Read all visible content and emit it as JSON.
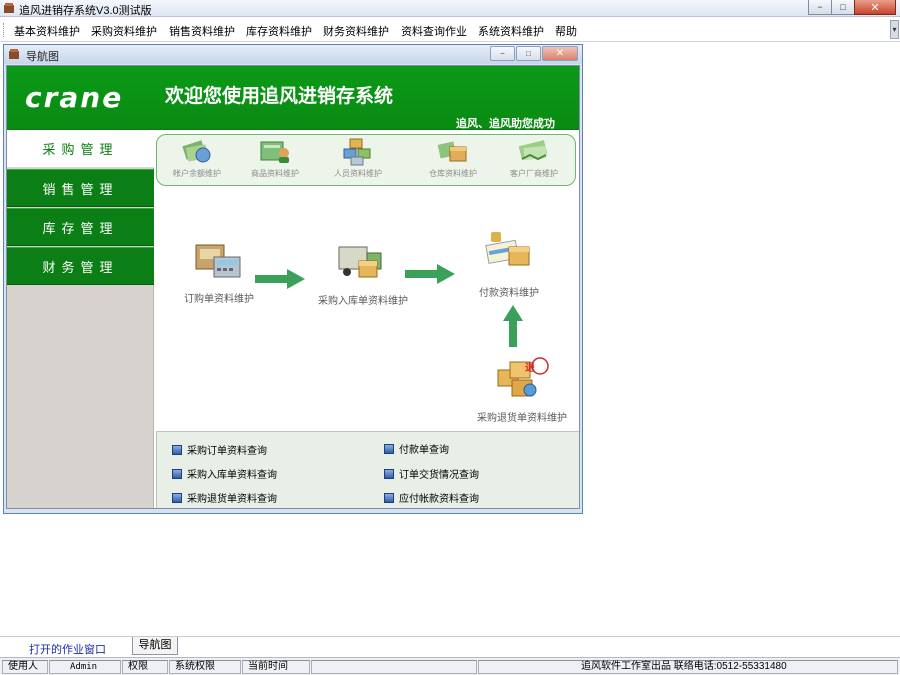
{
  "app": {
    "title": "追风进销存系统V3.0测试版"
  },
  "window_controls": {
    "minimize": "−",
    "maximize": "□",
    "close": "✕"
  },
  "menu": [
    "基本资料维护",
    "采购资料维护",
    "销售资料维护",
    "库存资料维护",
    "财务资料维护",
    "资料查询作业",
    "系统资料维护",
    "帮助"
  ],
  "child_window": {
    "title": "导航图"
  },
  "banner": {
    "logo": "crane",
    "welcome": "欢迎您使用追风进销存系统",
    "slogan": "追风、追风助您成功"
  },
  "nav": [
    {
      "label": "采购管理",
      "active": true
    },
    {
      "label": "销售管理",
      "active": false
    },
    {
      "label": "库存管理",
      "active": false
    },
    {
      "label": "财务管理",
      "active": false
    }
  ],
  "resources": [
    "帐户余额维护",
    "商品资料维护",
    "人员资料维护",
    "仓库资料维护",
    "客户厂商维护"
  ],
  "flow": {
    "order": "订购单资料维护",
    "receive": "采购入库单资料维护",
    "payment": "付款资料维护",
    "return": "采购退货单资料维护",
    "return_badge": "退"
  },
  "queries": {
    "left": [
      "采购订单资料查询",
      "采购入库单资料查询",
      "采购退货单资料查询"
    ],
    "right": [
      "付款单查询",
      "订单交货情况查询",
      "应付帐款资料查询"
    ]
  },
  "taskbar": {
    "open_windows": "打开的作业窗口",
    "tab": "导航图"
  },
  "status": {
    "user_label": "使用人",
    "user": "Admin",
    "perm_label": "权限",
    "perm": "系统权限",
    "time_label": "当前时间",
    "time": "",
    "footer": "追风软件工作室出品 联络电话:0512-55331480"
  },
  "colors": {
    "brand_green": "#0b8a14",
    "nav_green": "#0b7e15",
    "arrow_green": "#3aa05a"
  }
}
